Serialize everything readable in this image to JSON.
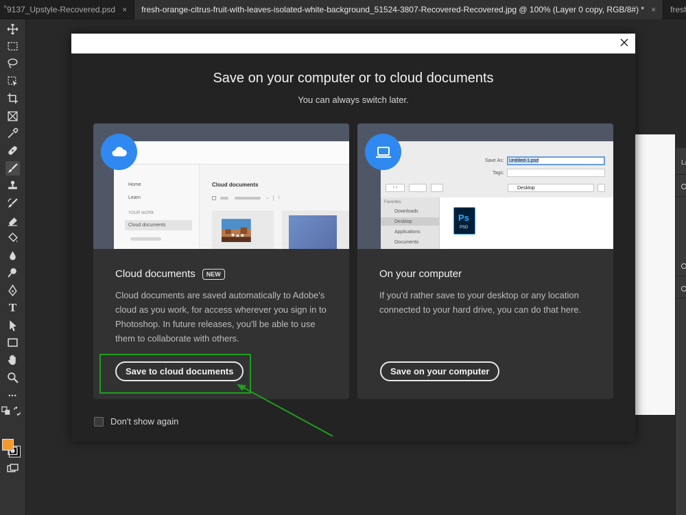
{
  "tabs": [
    {
      "label": "9137_Upstyle-Recovered.psd",
      "close": "×"
    },
    {
      "label": "fresh-orange-citrus-fruit-with-leaves-isolated-white-background_51524-3807-Recovered-Recovered.jpg @ 100% (Layer 0 copy, RGB/8#) *",
      "close": "×"
    },
    {
      "label": "fresh-o"
    }
  ],
  "corner_mark": "»",
  "colors": {
    "accent_blue": "#2f89f0",
    "foreground_swatch": "#f29a2e",
    "background_swatch": "#0a0a0a",
    "annotation_green": "#1f9f1f"
  },
  "tools": [
    "move-icon",
    "marquee-icon",
    "lasso-icon",
    "object-select-icon",
    "crop-icon",
    "frame-icon",
    "eyedropper-icon",
    "healing-brush-icon",
    "brush-icon",
    "stamp-icon",
    "history-brush-icon",
    "eraser-icon",
    "paint-bucket-icon",
    "blur-icon",
    "dodge-icon",
    "pen-icon",
    "type-icon",
    "path-select-icon",
    "rectangle-icon",
    "hand-icon",
    "zoom-icon",
    "more-icon"
  ],
  "tool_type_glyph": "T",
  "tool_more_glyph": "•••",
  "right_panel_label": "La",
  "dialog": {
    "title": "Save on your computer or to cloud documents",
    "subtitle": "You can always switch later.",
    "dont_show_label": "Don't show again",
    "close_icon": "close-icon"
  },
  "cloud_card": {
    "heading": "Cloud documents",
    "badge": "NEW",
    "description": "Cloud documents are saved automatically to Adobe's cloud as you work, for access wherever you sign in to Photoshop. In future releases, you'll be able to use them to collaborate with others.",
    "button": "Save to cloud documents",
    "icon": "cloud-icon",
    "mock": {
      "nav": [
        "Home",
        "Learn"
      ],
      "section": "YOUR WORK",
      "selected": "Cloud documents",
      "panel_title": "Cloud documents"
    }
  },
  "computer_card": {
    "heading": "On your computer",
    "description": "If you'd rather save to your desktop or any location connected to your hard drive, you can do that here.",
    "button": "Save on your computer",
    "icon": "laptop-icon",
    "mock": {
      "save_as_label": "Save As:",
      "save_as_value": "Untitled-1.psd",
      "tags_label": "Tags:",
      "location": "Desktop",
      "favorites_label": "Favorites",
      "favorites": [
        "Downloads",
        "Desktop",
        "Applications",
        "Documents"
      ],
      "file_icon_top": "Ps",
      "file_icon_bottom": "PSD"
    }
  }
}
